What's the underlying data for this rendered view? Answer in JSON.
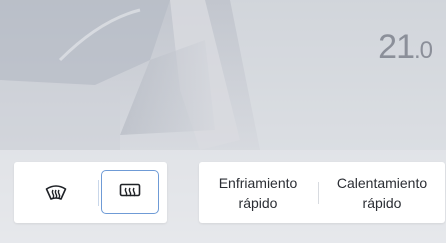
{
  "temperature": {
    "whole": "21",
    "decimal": ".0"
  },
  "defrost": {
    "front_icon": "front-windshield-defrost-icon",
    "rear_icon": "rear-window-defrost-icon",
    "rear_active": true,
    "accent_color": "#6f9bd6"
  },
  "modes": {
    "quick_cool_label": "Enfriamiento\nrápido",
    "quick_heat_label": "Calentamiento\nrápido"
  }
}
